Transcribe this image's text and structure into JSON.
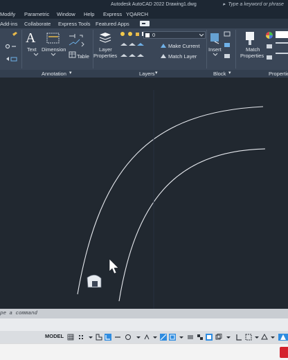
{
  "titlebar": {
    "app_title": "Autodesk AutoCAD 2022    Drawing1.dwg",
    "search_placeholder": "Type a keyword or phrase"
  },
  "menu": [
    "Modify",
    "Parametric",
    "Window",
    "Help",
    "Express",
    "YQARCH"
  ],
  "ribbon_tabs": [
    "Add-ins",
    "Collaborate",
    "Express Tools",
    "Featured Apps"
  ],
  "ribbon": {
    "text_label": "Text",
    "dimension_label": "Dimension",
    "table_label": "Table",
    "layer_properties_label": "Layer\nProperties",
    "layer_properties_line1": "Layer",
    "layer_properties_line2": "Properties",
    "layer_dropdown_value": "0",
    "make_current_label": "Make Current",
    "match_layer_label": "Match Layer",
    "insert_label": "Insert",
    "match_properties_line1": "Match",
    "match_properties_line2": "Properties"
  },
  "panels": {
    "annotation": "Annotation",
    "layers": "Layers",
    "block": "Block",
    "properties": "Propertie"
  },
  "command_line": {
    "prompt": "pe a command"
  },
  "statusbar": {
    "model_label": "MODEL"
  },
  "colors": {
    "canvas_bg": "#212830",
    "ribbon_bg": "#3a4657",
    "title_bg": "#1d2733",
    "curve_stroke": "#e6e9ee",
    "accent_blue": "#2f8ce0",
    "taskbar_app": "#d4202c"
  },
  "icons": [
    "search-icon",
    "text-icon",
    "dimension-icon",
    "table-icon",
    "layer-properties-icon",
    "insert-icon",
    "match-properties-icon",
    "color-wheel-icon",
    "crosshair-cursor-icon",
    "model-grid-icon"
  ]
}
